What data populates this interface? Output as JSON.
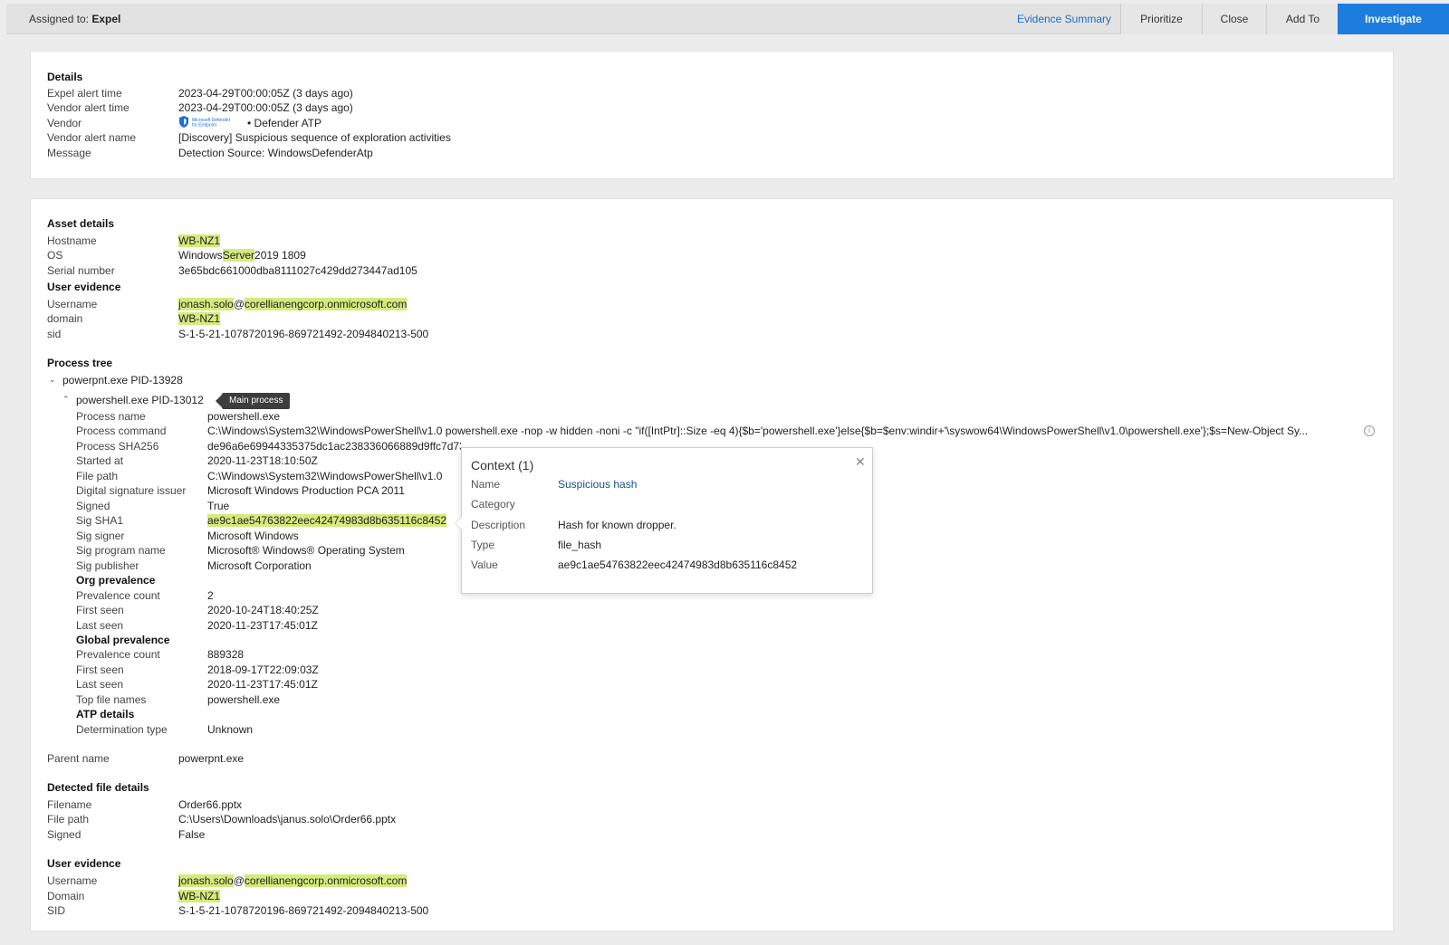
{
  "topbar": {
    "assigned_label": "Assigned to: ",
    "assigned_value": "Expel",
    "evidence_summary": "Evidence Summary",
    "prioritize": "Prioritize",
    "close": "Close",
    "add_to": "Add To",
    "investigate": "Investigate"
  },
  "details": {
    "heading": "Details",
    "rows": [
      {
        "label": "Expel alert time",
        "value": "2023-04-29T00:00:05Z (3 days ago)"
      },
      {
        "label": "Vendor alert time",
        "value": "2023-04-29T00:00:05Z (3 days ago)"
      },
      {
        "label": "Vendor",
        "value": "•  Defender ATP",
        "logo_text": "Microsoft Defender for Endpoint"
      },
      {
        "label": "Vendor alert name",
        "value": "[Discovery] Suspicious sequence of exploration activities"
      },
      {
        "label": "Message",
        "value": "Detection Source: WindowsDefenderAtp"
      }
    ]
  },
  "asset": {
    "heading": "Asset details",
    "hostname_label": "Hostname",
    "hostname": "WB-NZ1",
    "os_label": "OS",
    "os_part1": "Windows",
    "os_part2": "Server",
    "os_part3": "2019 1809",
    "serial_label": "Serial number",
    "serial": "3e65bdc661000dba8111027c429dd273447ad105"
  },
  "user_evidence_1": {
    "heading": "User evidence",
    "username_label": "Username",
    "username_part1": "jonash.solo",
    "username_at": "@",
    "username_part2": "corellianengcorp.onmicrosoft.com",
    "domain_label": "domain",
    "domain": "WB-NZ1",
    "sid_label": "sid",
    "sid": "S-1-5-21-1078720196-869721492-2094840213-500"
  },
  "process_tree": {
    "heading": "Process tree",
    "parent_node": "powerpnt.exe PID-13928",
    "child_node": "powershell.exe PID-13012",
    "main_tag": "Main process",
    "rows": [
      {
        "label": "Process name",
        "value": "powershell.exe"
      },
      {
        "label": "Process command",
        "value": "C:\\Windows\\System32\\WindowsPowerShell\\v1.0 powershell.exe -nop -w hidden -noni -c \"if([IntPtr]::Size -eq 4){$b='powershell.exe'}else{$b=$env:windir+'\\syswow64\\WindowsPowerShell\\v1.0\\powershell.exe'};$s=New-Object Sy..."
      },
      {
        "label": "Process SHA256",
        "value": "de96a6e69944335375dc1ac238336066889d9ffc7d73628ef4fe1b1b160ab32c  •  ∑ 0 / 71"
      },
      {
        "label": "Started at",
        "value": "2020-11-23T18:10:50Z"
      },
      {
        "label": "File path",
        "value": "C:\\Windows\\System32\\WindowsPowerShell\\v1.0"
      },
      {
        "label": "Digital signature issuer",
        "value": "Microsoft Windows Production PCA 2011"
      },
      {
        "label": "Signed",
        "value": "True"
      },
      {
        "label": "Sig SHA1",
        "value": "ae9c1ae54763822eec42474983d8b635116c8452"
      },
      {
        "label": "Sig signer",
        "value": "Microsoft Windows"
      },
      {
        "label": "Sig program name",
        "value": "Microsoft® Windows® Operating System"
      },
      {
        "label": "Sig publisher",
        "value": "Microsoft Corporation"
      }
    ],
    "org_prevalence": "Org prevalence",
    "org_rows": [
      {
        "label": "Prevalence count",
        "value": "2"
      },
      {
        "label": "First seen",
        "value": "2020-10-24T18:40:25Z"
      },
      {
        "label": "Last seen",
        "value": "2020-11-23T17:45:01Z"
      }
    ],
    "global_prevalence": "Global prevalence",
    "global_rows": [
      {
        "label": "Prevalence count",
        "value": "889328"
      },
      {
        "label": "First seen",
        "value": "2018-09-17T22:09:03Z"
      },
      {
        "label": "Last seen",
        "value": "2020-11-23T17:45:01Z"
      },
      {
        "label": "Top file names",
        "value": "powershell.exe"
      }
    ],
    "atp_details": "ATP details",
    "atp_rows": [
      {
        "label": "Determination type",
        "value": "Unknown"
      }
    ],
    "parent_name_label": "Parent name",
    "parent_name": "powerpnt.exe"
  },
  "detected_file": {
    "heading": "Detected file details",
    "rows": [
      {
        "label": "Filename",
        "value": "Order66.pptx"
      },
      {
        "label": "File path",
        "value": "C:\\Users\\Downloads\\janus.solo\\Order66.pptx"
      },
      {
        "label": "Signed",
        "value": "False"
      }
    ]
  },
  "user_evidence_2": {
    "heading": "User evidence",
    "username_label": "Username",
    "username_part1": "jonash.solo",
    "username_at": "@",
    "username_part2": "corellianengcorp.onmicrosoft.com",
    "domain_label": "Domain",
    "domain": "WB-NZ1",
    "sid_label": "SID",
    "sid": "S-1-5-21-1078720196-869721492-2094840213-500"
  },
  "context_popup": {
    "title": "Context (1)",
    "close_glyph": "✕",
    "rows": [
      {
        "label": "Name",
        "value": "Suspicious hash"
      },
      {
        "label": "Category",
        "value": ""
      },
      {
        "label": "Description",
        "value": "Hash for known dropper."
      },
      {
        "label": "Type",
        "value": "file_hash"
      },
      {
        "label": "Value",
        "value": "ae9c1ae54763822eec42474983d8b635116c8452"
      }
    ]
  },
  "colors": {
    "accent": "#1c7ddf",
    "highlight": "#d4ea7c",
    "link": "#1a6ec4"
  }
}
